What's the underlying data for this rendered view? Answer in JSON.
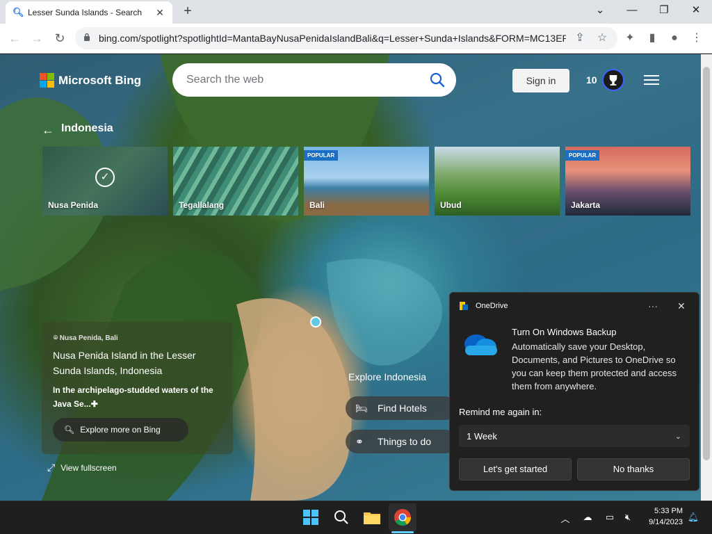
{
  "browser": {
    "tab_title": "Lesser Sunda Islands - Search",
    "url": "bing.com/spotlight?spotlightId=MantaBayNusaPenidaIslandBali&q=Lesser+Sunda+Islands&FORM=MC13ER"
  },
  "header": {
    "logo_text": "Microsoft Bing",
    "search_placeholder": "Search the web",
    "signin_label": "Sign in",
    "rewards_count": "10"
  },
  "breadcrumb": {
    "label": "Indonesia"
  },
  "carousel": [
    {
      "label": "Nusa Penida",
      "badge": "",
      "selected": true
    },
    {
      "label": "Tegallalang",
      "badge": ""
    },
    {
      "label": "Bali",
      "badge": "POPULAR"
    },
    {
      "label": "Ubud",
      "badge": ""
    },
    {
      "label": "Jakarta",
      "badge": "POPULAR"
    }
  ],
  "info": {
    "location": "Nusa Penida, Bali",
    "title": "Nusa Penida Island in the Lesser Sunda Islands, Indonesia",
    "description": "In the archipelago-studded waters of the Java Se...",
    "explore_label": "Explore more on Bing",
    "fullscreen_label": "View fullscreen"
  },
  "explore": {
    "heading": "Explore Indonesia",
    "hotels_label": "Find Hotels",
    "things_label": "Things to do"
  },
  "onedrive": {
    "app_name": "OneDrive",
    "heading": "Turn On Windows Backup",
    "body": "Automatically save your Desktop, Documents, and Pictures to OneDrive so you can keep them protected and access them from anywhere.",
    "remind_label": "Remind me again in:",
    "remind_value": "1 Week",
    "primary_label": "Let's get started",
    "secondary_label": "No thanks"
  },
  "taskbar": {
    "time": "5:33 PM",
    "date": "9/14/2023"
  },
  "colors": {
    "bing_accent": "#3b62ff",
    "onedrive_blue": "#0f6cbd",
    "toast_bg": "#202020",
    "popular_badge": "#1b6ec2"
  }
}
